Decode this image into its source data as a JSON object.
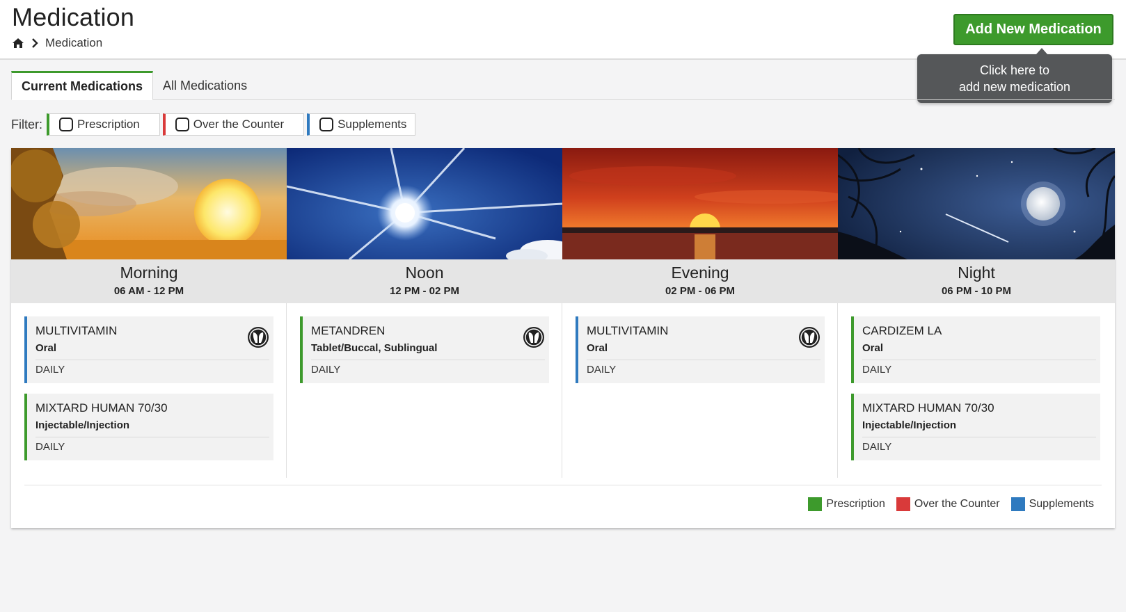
{
  "header": {
    "title": "Medication",
    "breadcrumb": {
      "home_icon": "home-icon",
      "current": "Medication"
    },
    "add_button": "Add New Medication",
    "tooltip": {
      "line1": "Click here to",
      "line2": "add new medication"
    }
  },
  "tabs": [
    {
      "label": "Current Medications",
      "active": true
    },
    {
      "label": "All Medications",
      "active": false
    }
  ],
  "filter": {
    "label": "Filter:",
    "options": [
      {
        "label": "Prescription",
        "color": "#3d9a2c",
        "checked": false
      },
      {
        "label": "Over the Counter",
        "color": "#d93a3a",
        "checked": false
      },
      {
        "label": "Supplements",
        "color": "#2f7abf",
        "checked": false
      }
    ]
  },
  "columns": [
    {
      "name": "Morning",
      "time": "06 AM - 12 PM",
      "cards": [
        {
          "name": "MULTIVITAMIN",
          "route": "Oral",
          "freq": "DAILY",
          "type": "supplement-prescription",
          "icon": "pill-icon"
        },
        {
          "name": "MIXTARD HUMAN 70/30",
          "route": "Injectable/Injection",
          "freq": "DAILY",
          "type": "prescription"
        }
      ]
    },
    {
      "name": "Noon",
      "time": "12 PM - 02 PM",
      "cards": [
        {
          "name": "METANDREN",
          "route": "Tablet/Buccal, Sublingual",
          "freq": "DAILY",
          "type": "prescription",
          "icon": "pill-icon"
        }
      ]
    },
    {
      "name": "Evening",
      "time": "02 PM - 06 PM",
      "cards": [
        {
          "name": "MULTIVITAMIN",
          "route": "Oral",
          "freq": "DAILY",
          "type": "supplement",
          "icon": "pill-icon"
        }
      ]
    },
    {
      "name": "Night",
      "time": "06 PM - 10 PM",
      "cards": [
        {
          "name": "CARDIZEM LA",
          "route": "Oral",
          "freq": "DAILY",
          "type": "prescription"
        },
        {
          "name": "MIXTARD HUMAN 70/30",
          "route": "Injectable/Injection",
          "freq": "DAILY",
          "type": "prescription"
        }
      ]
    }
  ],
  "legend": [
    {
      "label": "Prescription",
      "color": "#3d9a2c"
    },
    {
      "label": "Over the Counter",
      "color": "#d93a3a"
    },
    {
      "label": "Supplements",
      "color": "#2f7abf"
    }
  ]
}
